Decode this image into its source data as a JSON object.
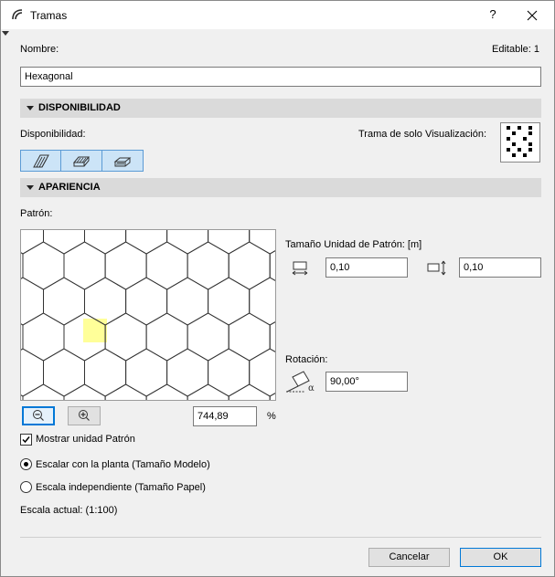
{
  "window": {
    "title": "Tramas",
    "help": "?"
  },
  "name": {
    "label": "Nombre:",
    "value": "Hexagonal",
    "editable": "Editable: 1"
  },
  "availability": {
    "section_title": "DISPONIBILIDAD",
    "label": "Disponibilidad:",
    "display_only_label": "Trama de solo Visualización:",
    "buttons": [
      "drafting-fill-icon",
      "cut-fill-icon",
      "cover-fill-icon"
    ]
  },
  "appearance": {
    "section_title": "APARIENCIA",
    "pattern_label": "Patrón:",
    "unit_size_label": "Tamaño Unidad de Patrón: [m]",
    "width_value": "0,10",
    "height_value": "0,10",
    "rotation_label": "Rotación:",
    "rotation_value": "90,00°",
    "zoom_value": "744,89",
    "zoom_unit": "%",
    "show_unit_label": "Mostrar unidad Patrón",
    "show_unit_checked": true,
    "scale_model_label": "Escalar con la planta (Tamaño Modelo)",
    "scale_paper_label": "Escala independiente (Tamaño Papel)",
    "scale_selected": "model",
    "current_scale": "Escala actual: (1:100)",
    "highlight_color": "#ffff99"
  },
  "footer": {
    "cancel_label": "Cancelar",
    "ok_label": "OK"
  },
  "colors": {
    "accent": "#0078d7",
    "section_bg": "#dadada",
    "toggle_bg": "#cce4f7"
  }
}
